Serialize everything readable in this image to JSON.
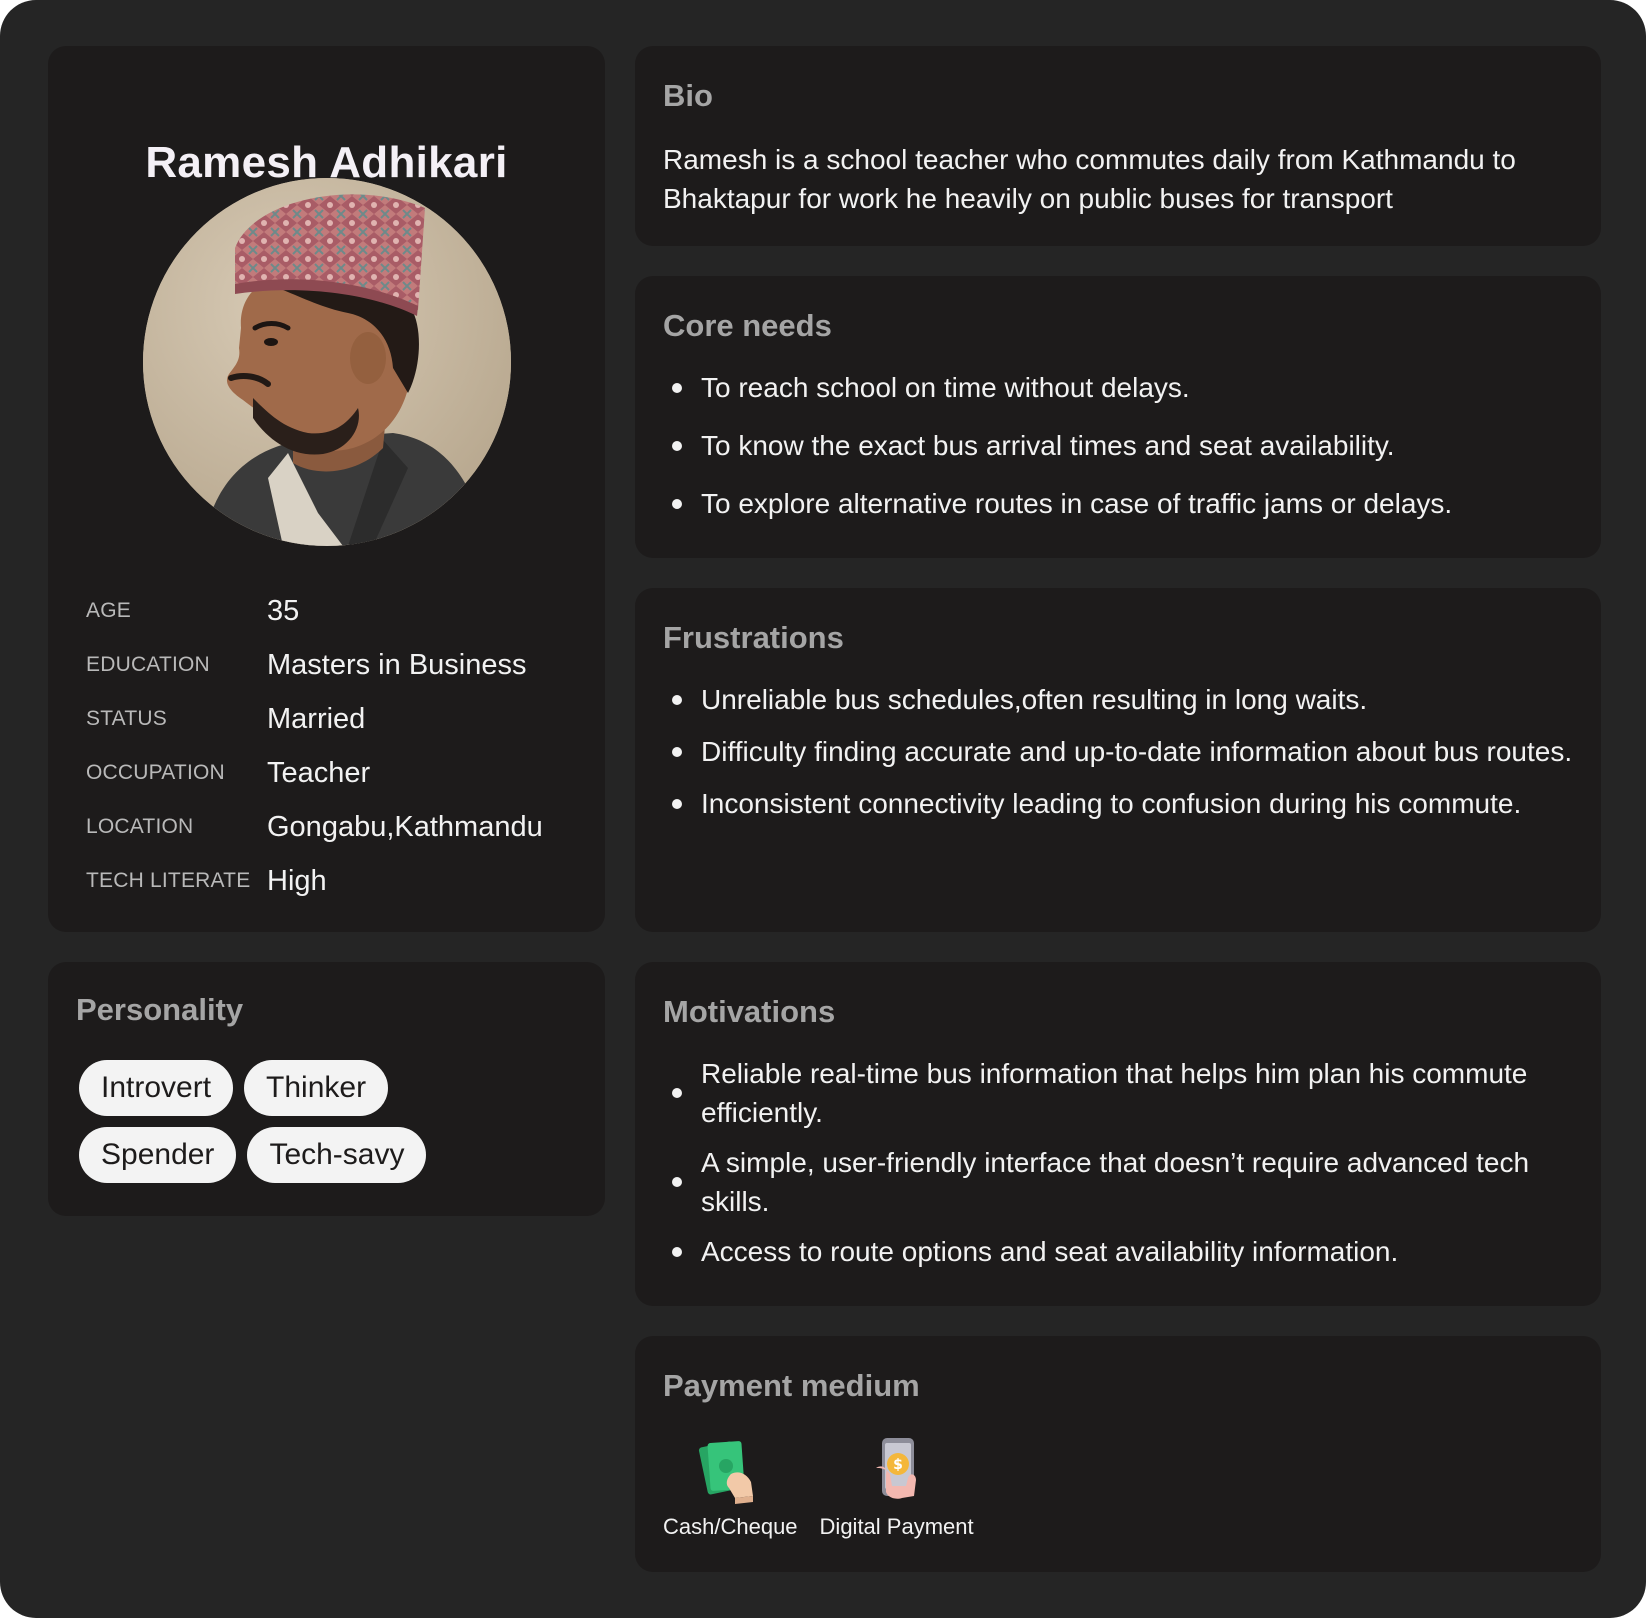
{
  "profile": {
    "name": "Ramesh Adhikari",
    "facts": [
      {
        "label": "AGE",
        "value": "35"
      },
      {
        "label": "EDUCATION",
        "value": "Masters in Business"
      },
      {
        "label": "STATUS",
        "value": "Married"
      },
      {
        "label": "OCCUPATION",
        "value": "Teacher"
      },
      {
        "label": "LOCATION",
        "value": "Gongabu,Kathmandu"
      },
      {
        "label": "TECH LITERATE",
        "value": "High"
      }
    ]
  },
  "personality": {
    "title": "Personality",
    "traits": [
      "Introvert",
      "Thinker",
      "Spender",
      "Tech-savy"
    ]
  },
  "bio": {
    "title": "Bio",
    "text": "Ramesh is a school  teacher who commutes daily from Kathmandu to Bhaktapur for work he heavily on public buses for transport"
  },
  "core_needs": {
    "title": "Core needs",
    "items": [
      "To reach school on time without  delays.",
      "To know the exact bus arrival times and seat availability.",
      "To explore alternative routes in case of traffic jams or delays."
    ]
  },
  "frustrations": {
    "title": "Frustrations",
    "items": [
      "Unreliable bus schedules,often resulting in long waits.",
      "Difficulty finding accurate and up-to-date information about bus routes.",
      "Inconsistent connectivity leading to confusion during his commute."
    ]
  },
  "motivations": {
    "title": "Motivations",
    "items": [
      "Reliable real-time bus information that helps him plan his commute efficiently.",
      "A simple, user-friendly interface that doesn’t require advanced tech skills.",
      "Access to route options and seat availability information."
    ]
  },
  "payment": {
    "title": "Payment medium",
    "methods": [
      {
        "label": "Cash/Cheque",
        "icon": "cash-in-hand-icon"
      },
      {
        "label": "Digital Payment",
        "icon": "phone-payment-icon"
      }
    ]
  },
  "colors": {
    "background": "#252525",
    "card": "#1d1b1b",
    "heading": "#a5a5a5",
    "text": "#f2f2f2",
    "chip": "#f3f3f3"
  }
}
